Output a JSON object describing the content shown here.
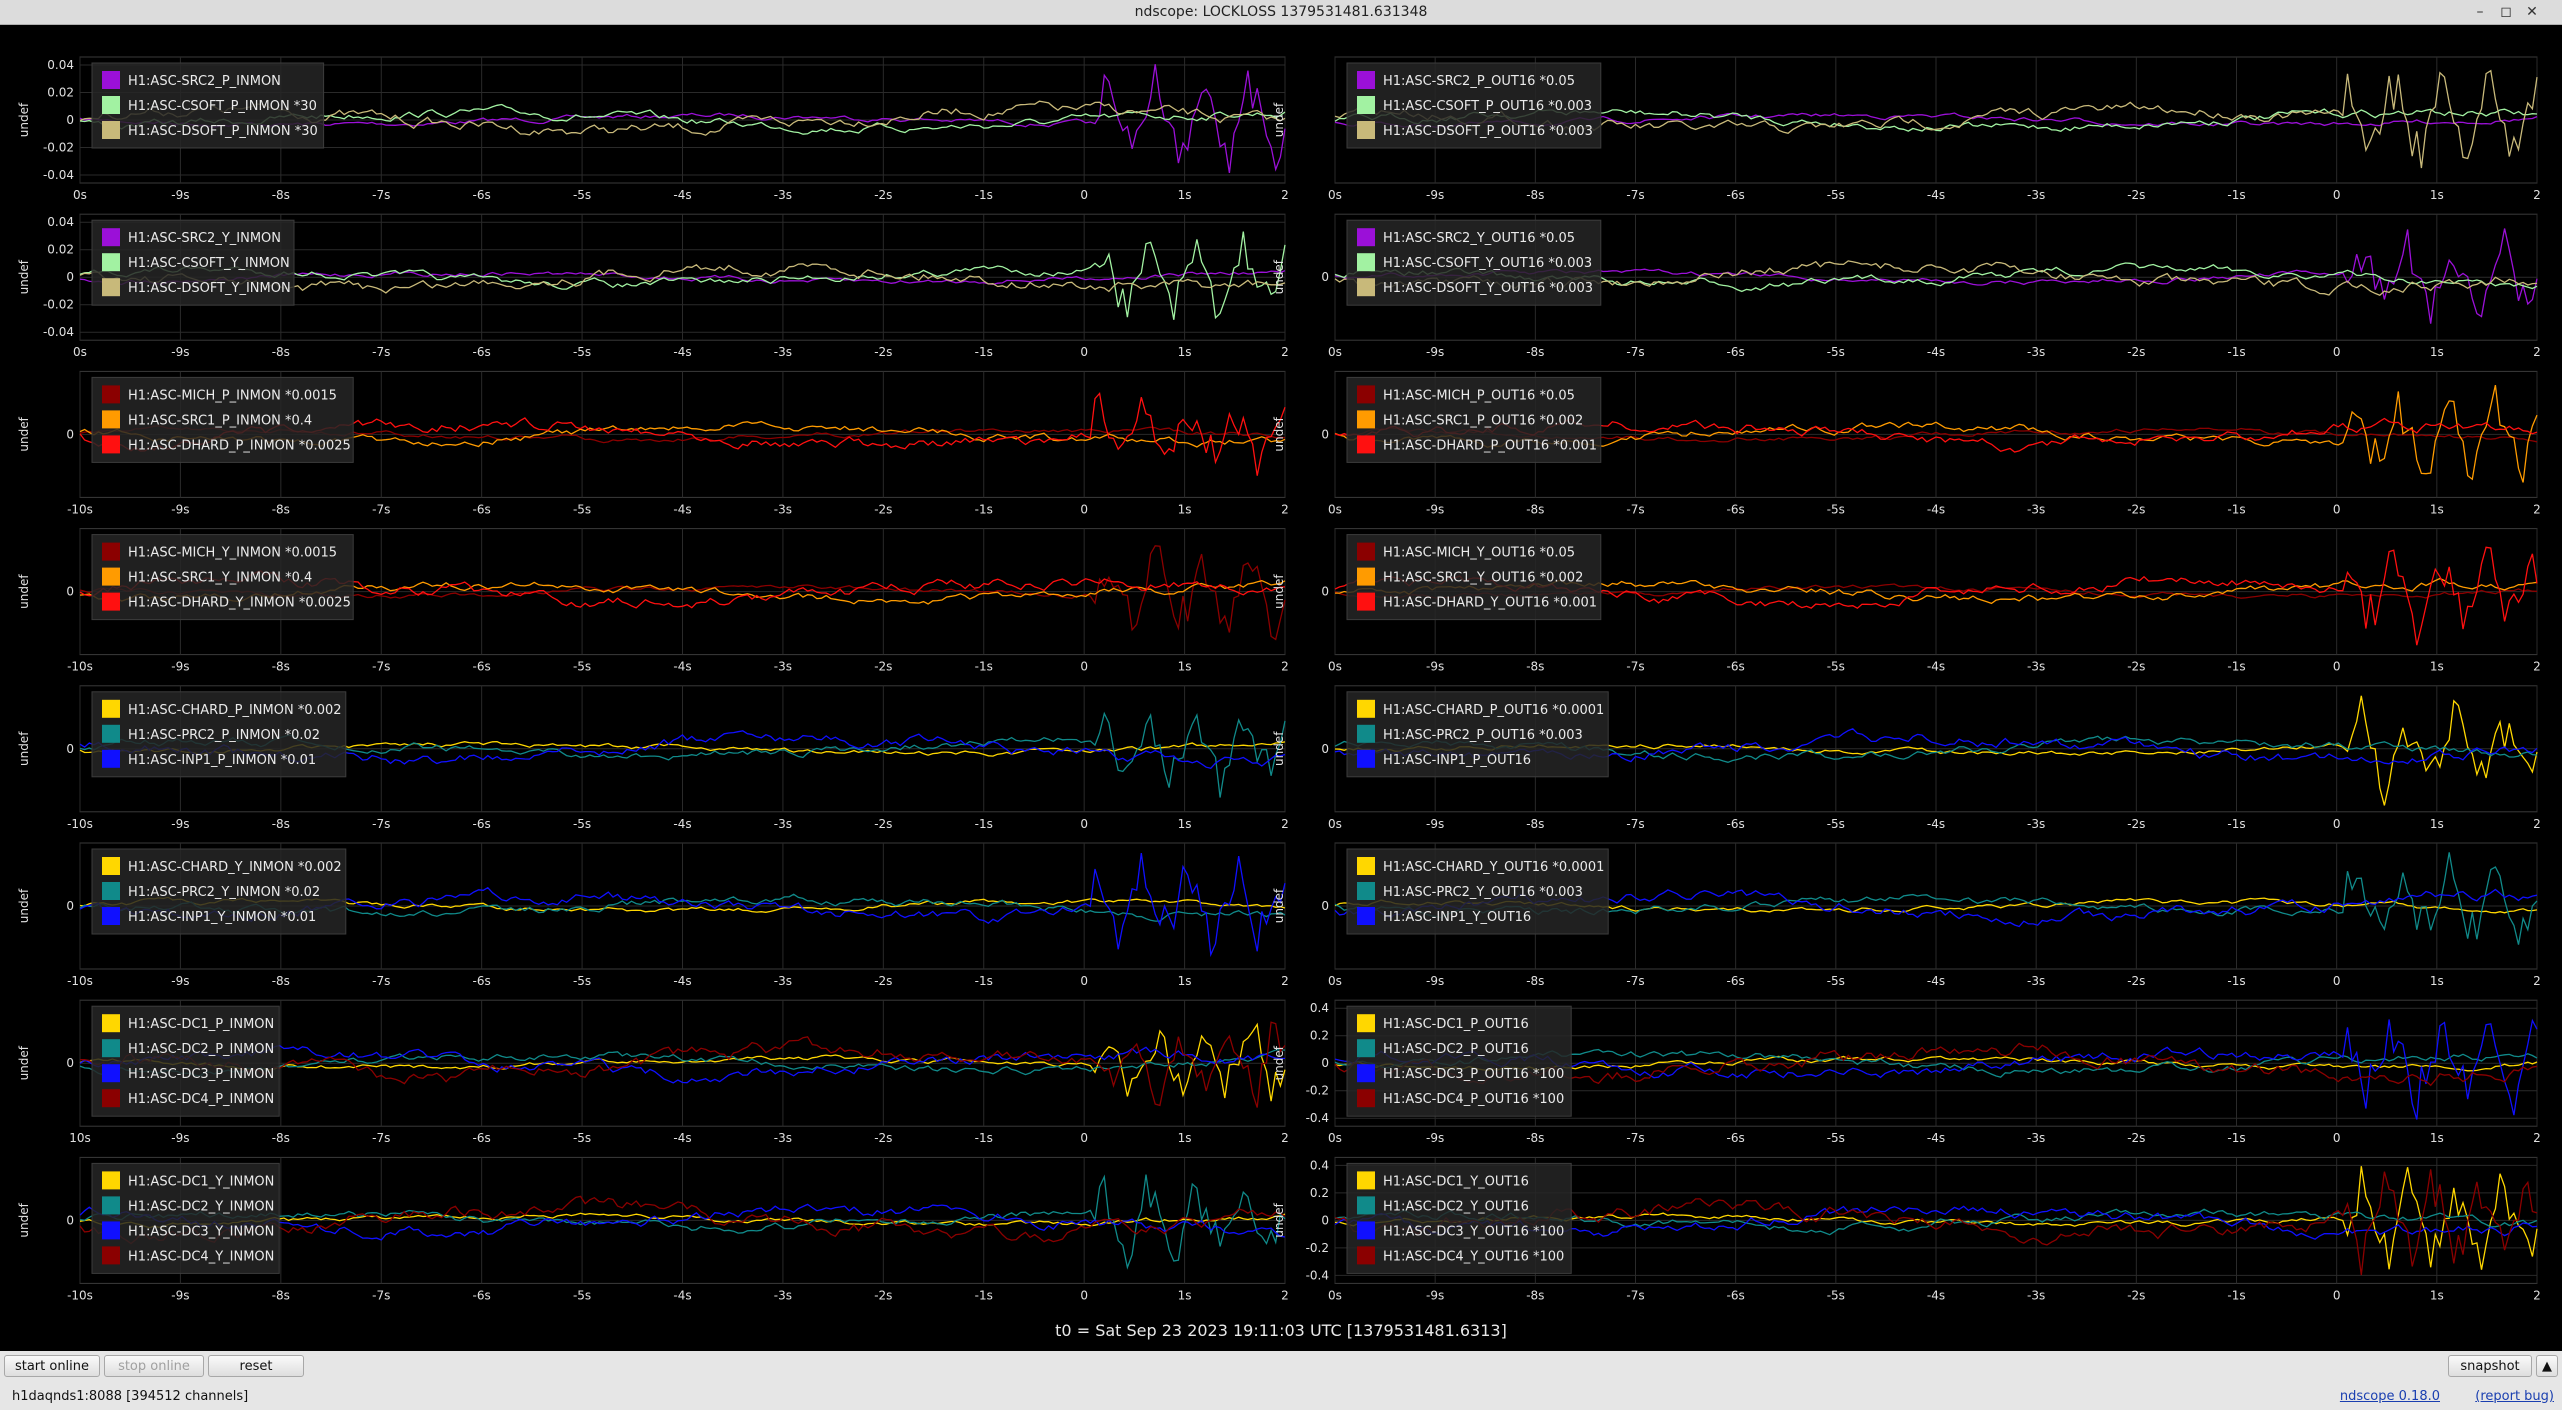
{
  "window": {
    "title": "ndscope: LOCKLOSS 1379531481.631348",
    "buttons": {
      "minimize": "–",
      "maximize": "◻",
      "close": "✕"
    }
  },
  "t0_label": "t0 = Sat Sep 23 2023 19:11:03 UTC [1379531481.6313]",
  "toolbar": {
    "start_online": "start online",
    "stop_online": "stop online",
    "reset": "reset",
    "snapshot": "snapshot",
    "menu_arrow": "▲"
  },
  "status": {
    "server": "h1daqnds1:8088  [394512 channels]",
    "version": "ndscope 0.18.0",
    "report": "(report bug)"
  },
  "colors": {
    "background": "#000000",
    "grid": "#2a2a2a",
    "axis_text": "#e0e0e0",
    "legend_bg": "#262626"
  },
  "chart_data": [
    {
      "type": "line",
      "ylabel": "undef",
      "ticks_y": [
        "0.04",
        "0.02",
        "0",
        "-0.02",
        "-0.04"
      ],
      "ticks_x": [
        "0s",
        "-9s",
        "-8s",
        "-7s",
        "-6s",
        "-5s",
        "-4s",
        "-3s",
        "-2s",
        "-1s",
        "0",
        "1s",
        "2"
      ],
      "xlim": [
        -10,
        2
      ],
      "series": [
        {
          "name": "H1:ASC-SRC2_P_INMON",
          "color": "#9b10d8"
        },
        {
          "name": "H1:ASC-CSOFT_P_INMON *30",
          "color": "#a2f2a2"
        },
        {
          "name": "H1:ASC-DSOFT_P_INMON *30",
          "color": "#c8b97a"
        }
      ]
    },
    {
      "type": "line",
      "ylabel": "undef",
      "ticks_y": [],
      "ticks_x": [
        "0s",
        "-9s",
        "-8s",
        "-7s",
        "-6s",
        "-5s",
        "-4s",
        "-3s",
        "-2s",
        "-1s",
        "0",
        "1s",
        "2"
      ],
      "xlim": [
        -10,
        2
      ],
      "series": [
        {
          "name": "H1:ASC-SRC2_P_OUT16 *0.05",
          "color": "#9b10d8"
        },
        {
          "name": "H1:ASC-CSOFT_P_OUT16 *0.003",
          "color": "#a2f2a2"
        },
        {
          "name": "H1:ASC-DSOFT_P_OUT16 *0.003",
          "color": "#c8b97a"
        }
      ]
    },
    {
      "type": "line",
      "ylabel": "undef",
      "ticks_y": [
        "0.04",
        "0.02",
        "0",
        "-0.02",
        "-0.04"
      ],
      "ticks_x": [
        "0s",
        "-9s",
        "-8s",
        "-7s",
        "-6s",
        "-5s",
        "-4s",
        "-3s",
        "-2s",
        "-1s",
        "0",
        "1s",
        "2"
      ],
      "xlim": [
        -10,
        2
      ],
      "series": [
        {
          "name": "H1:ASC-SRC2_Y_INMON",
          "color": "#9b10d8"
        },
        {
          "name": "H1:ASC-CSOFT_Y_INMON",
          "color": "#a2f2a2"
        },
        {
          "name": "H1:ASC-DSOFT_Y_INMON",
          "color": "#c8b97a"
        }
      ]
    },
    {
      "type": "line",
      "ylabel": "undef",
      "ticks_y": [
        "0"
      ],
      "ticks_x": [
        "0s",
        "-9s",
        "-8s",
        "-7s",
        "-6s",
        "-5s",
        "-4s",
        "-3s",
        "-2s",
        "-1s",
        "0",
        "1s",
        "2"
      ],
      "xlim": [
        -10,
        2
      ],
      "series": [
        {
          "name": "H1:ASC-SRC2_Y_OUT16 *0.05",
          "color": "#9b10d8"
        },
        {
          "name": "H1:ASC-CSOFT_Y_OUT16 *0.003",
          "color": "#a2f2a2"
        },
        {
          "name": "H1:ASC-DSOFT_Y_OUT16 *0.003",
          "color": "#c8b97a"
        }
      ]
    },
    {
      "type": "line",
      "ylabel": "undef",
      "ticks_y": [
        "0"
      ],
      "ticks_x": [
        "-10s",
        "-9s",
        "-8s",
        "-7s",
        "-6s",
        "-5s",
        "-4s",
        "-3s",
        "-2s",
        "-1s",
        "0",
        "1s",
        "2"
      ],
      "xlim": [
        -10,
        2
      ],
      "series": [
        {
          "name": "H1:ASC-MICH_P_INMON *0.0015",
          "color": "#8b0000"
        },
        {
          "name": "H1:ASC-SRC1_P_INMON *0.4",
          "color": "#ff9b00"
        },
        {
          "name": "H1:ASC-DHARD_P_INMON *0.0025",
          "color": "#ff1010"
        }
      ]
    },
    {
      "type": "line",
      "ylabel": "undef",
      "ticks_y": [
        "0"
      ],
      "ticks_x": [
        "0s",
        "-9s",
        "-8s",
        "-7s",
        "-6s",
        "-5s",
        "-4s",
        "-3s",
        "-2s",
        "-1s",
        "0",
        "1s",
        "2"
      ],
      "xlim": [
        -10,
        2
      ],
      "series": [
        {
          "name": "H1:ASC-MICH_P_OUT16 *0.05",
          "color": "#8b0000"
        },
        {
          "name": "H1:ASC-SRC1_P_OUT16 *0.002",
          "color": "#ff9b00"
        },
        {
          "name": "H1:ASC-DHARD_P_OUT16 *0.001",
          "color": "#ff1010"
        }
      ]
    },
    {
      "type": "line",
      "ylabel": "undef",
      "ticks_y": [
        "0"
      ],
      "ticks_x": [
        "-10s",
        "-9s",
        "-8s",
        "-7s",
        "-6s",
        "-5s",
        "-4s",
        "-3s",
        "-2s",
        "-1s",
        "0",
        "1s",
        "2"
      ],
      "xlim": [
        -10,
        2
      ],
      "series": [
        {
          "name": "H1:ASC-MICH_Y_INMON *0.0015",
          "color": "#8b0000"
        },
        {
          "name": "H1:ASC-SRC1_Y_INMON *0.4",
          "color": "#ff9b00"
        },
        {
          "name": "H1:ASC-DHARD_Y_INMON *0.0025",
          "color": "#ff1010"
        }
      ]
    },
    {
      "type": "line",
      "ylabel": "undef",
      "ticks_y": [
        "0"
      ],
      "ticks_x": [
        "0s",
        "-9s",
        "-8s",
        "-7s",
        "-6s",
        "-5s",
        "-4s",
        "-3s",
        "-2s",
        "-1s",
        "0",
        "1s",
        "2"
      ],
      "xlim": [
        -10,
        2
      ],
      "series": [
        {
          "name": "H1:ASC-MICH_Y_OUT16 *0.05",
          "color": "#8b0000"
        },
        {
          "name": "H1:ASC-SRC1_Y_OUT16 *0.002",
          "color": "#ff9b00"
        },
        {
          "name": "H1:ASC-DHARD_Y_OUT16 *0.001",
          "color": "#ff1010"
        }
      ]
    },
    {
      "type": "line",
      "ylabel": "undef",
      "ticks_y": [
        "0"
      ],
      "ticks_x": [
        "-10s",
        "-9s",
        "-8s",
        "-7s",
        "-6s",
        "-5s",
        "-4s",
        "-3s",
        "-2s",
        "-1s",
        "0",
        "1s",
        "2"
      ],
      "xlim": [
        -10,
        2
      ],
      "series": [
        {
          "name": "H1:ASC-CHARD_P_INMON *0.002",
          "color": "#ffd700"
        },
        {
          "name": "H1:ASC-PRC2_P_INMON *0.02",
          "color": "#108a8a"
        },
        {
          "name": "H1:ASC-INP1_P_INMON *0.01",
          "color": "#1010ff"
        }
      ]
    },
    {
      "type": "line",
      "ylabel": "undef",
      "ticks_y": [
        "0"
      ],
      "ticks_x": [
        "0s",
        "-9s",
        "-8s",
        "-7s",
        "-6s",
        "-5s",
        "-4s",
        "-3s",
        "-2s",
        "-1s",
        "0",
        "1s",
        "2"
      ],
      "xlim": [
        -10,
        2
      ],
      "series": [
        {
          "name": "H1:ASC-CHARD_P_OUT16 *0.0001",
          "color": "#ffd700"
        },
        {
          "name": "H1:ASC-PRC2_P_OUT16 *0.003",
          "color": "#108a8a"
        },
        {
          "name": "H1:ASC-INP1_P_OUT16",
          "color": "#1010ff"
        }
      ]
    },
    {
      "type": "line",
      "ylabel": "undef",
      "ticks_y": [
        "0"
      ],
      "ticks_x": [
        "-10s",
        "-9s",
        "-8s",
        "-7s",
        "-6s",
        "-5s",
        "-4s",
        "-3s",
        "-2s",
        "-1s",
        "0",
        "1s",
        "2"
      ],
      "xlim": [
        -10,
        2
      ],
      "series": [
        {
          "name": "H1:ASC-CHARD_Y_INMON *0.002",
          "color": "#ffd700"
        },
        {
          "name": "H1:ASC-PRC2_Y_INMON *0.02",
          "color": "#108a8a"
        },
        {
          "name": "H1:ASC-INP1_Y_INMON *0.01",
          "color": "#1010ff"
        }
      ]
    },
    {
      "type": "line",
      "ylabel": "undef",
      "ticks_y": [
        "0"
      ],
      "ticks_x": [
        "0s",
        "-9s",
        "-8s",
        "-7s",
        "-6s",
        "-5s",
        "-4s",
        "-3s",
        "-2s",
        "-1s",
        "0",
        "1s",
        "2"
      ],
      "xlim": [
        -10,
        2
      ],
      "series": [
        {
          "name": "H1:ASC-CHARD_Y_OUT16 *0.0001",
          "color": "#ffd700"
        },
        {
          "name": "H1:ASC-PRC2_Y_OUT16 *0.003",
          "color": "#108a8a"
        },
        {
          "name": "H1:ASC-INP1_Y_OUT16",
          "color": "#1010ff"
        }
      ]
    },
    {
      "type": "line",
      "ylabel": "undef",
      "ticks_y": [
        "0"
      ],
      "ticks_x": [
        "10s",
        "-9s",
        "-8s",
        "-7s",
        "-6s",
        "-5s",
        "-4s",
        "-3s",
        "-2s",
        "-1s",
        "0",
        "1s",
        "2"
      ],
      "xlim": [
        -10,
        2
      ],
      "series": [
        {
          "name": "H1:ASC-DC1_P_INMON",
          "color": "#ffd700"
        },
        {
          "name": "H1:ASC-DC2_P_INMON",
          "color": "#108a8a"
        },
        {
          "name": "H1:ASC-DC3_P_INMON",
          "color": "#1010ff"
        },
        {
          "name": "H1:ASC-DC4_P_INMON",
          "color": "#8b0000"
        }
      ]
    },
    {
      "type": "line",
      "ylabel": "undef",
      "ticks_y": [
        "0.4",
        "0.2",
        "0",
        "-0.2",
        "-0.4"
      ],
      "ticks_x": [
        "0s",
        "-9s",
        "-8s",
        "-7s",
        "-6s",
        "-5s",
        "-4s",
        "-3s",
        "-2s",
        "-1s",
        "0",
        "1s",
        "2"
      ],
      "xlim": [
        -10,
        2
      ],
      "series": [
        {
          "name": "H1:ASC-DC1_P_OUT16",
          "color": "#ffd700"
        },
        {
          "name": "H1:ASC-DC2_P_OUT16",
          "color": "#108a8a"
        },
        {
          "name": "H1:ASC-DC3_P_OUT16 *100",
          "color": "#1010ff"
        },
        {
          "name": "H1:ASC-DC4_P_OUT16 *100",
          "color": "#8b0000"
        }
      ]
    },
    {
      "type": "line",
      "ylabel": "undef",
      "ticks_y": [
        "0"
      ],
      "ticks_x": [
        "-10s",
        "-9s",
        "-8s",
        "-7s",
        "-6s",
        "-5s",
        "-4s",
        "-3s",
        "-2s",
        "-1s",
        "0",
        "1s",
        "2"
      ],
      "xlim": [
        -10,
        2
      ],
      "series": [
        {
          "name": "H1:ASC-DC1_Y_INMON",
          "color": "#ffd700"
        },
        {
          "name": "H1:ASC-DC2_Y_INMON",
          "color": "#108a8a"
        },
        {
          "name": "H1:ASC-DC3_Y_INMON",
          "color": "#1010ff"
        },
        {
          "name": "H1:ASC-DC4_Y_INMON",
          "color": "#8b0000"
        }
      ]
    },
    {
      "type": "line",
      "ylabel": "undef",
      "ticks_y": [
        "0.4",
        "0.2",
        "0",
        "-0.2",
        "-0.4"
      ],
      "ticks_x": [
        "0s",
        "-9s",
        "-8s",
        "-7s",
        "-6s",
        "-5s",
        "-4s",
        "-3s",
        "-2s",
        "-1s",
        "0",
        "1s",
        "2"
      ],
      "xlim": [
        -10,
        2
      ],
      "series": [
        {
          "name": "H1:ASC-DC1_Y_OUT16",
          "color": "#ffd700"
        },
        {
          "name": "H1:ASC-DC2_Y_OUT16",
          "color": "#108a8a"
        },
        {
          "name": "H1:ASC-DC3_Y_OUT16 *100",
          "color": "#1010ff"
        },
        {
          "name": "H1:ASC-DC4_Y_OUT16 *100",
          "color": "#8b0000"
        }
      ]
    }
  ]
}
